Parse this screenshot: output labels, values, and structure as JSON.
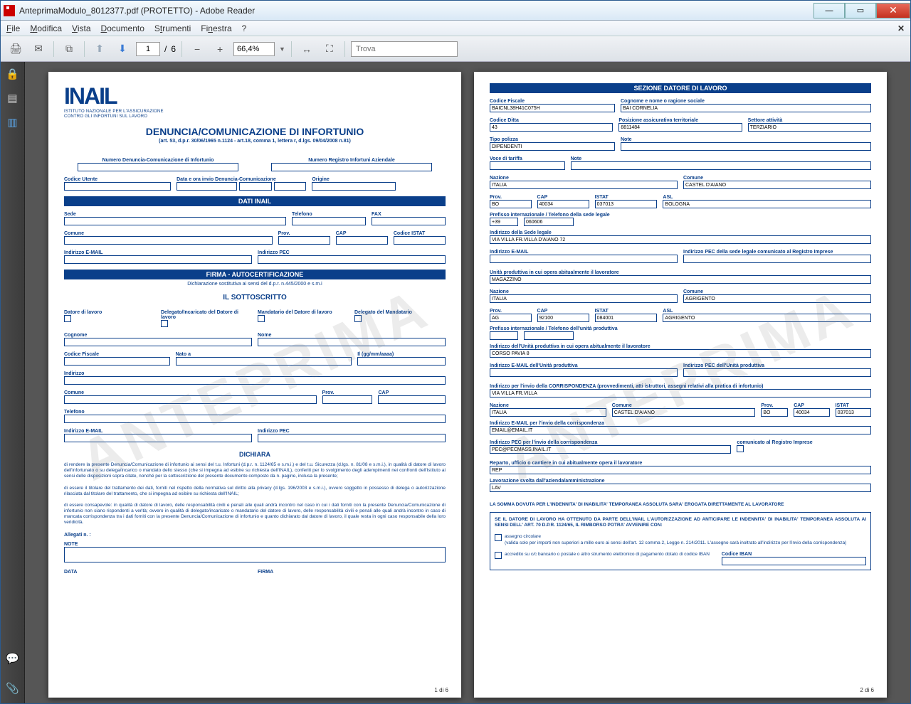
{
  "window": {
    "title": "AnteprimaModulo_8012377.pdf (PROTETTO) - Adobe Reader"
  },
  "menu": {
    "file": "File",
    "edit": "Modifica",
    "view": "Vista",
    "document": "Documento",
    "tools": "Strumenti",
    "window": "Finestra",
    "help": "?"
  },
  "toolbar": {
    "page_current": "1",
    "page_sep": "/",
    "page_total": "6",
    "zoom": "66,4%",
    "search_placeholder": "Trova"
  },
  "page1": {
    "logo": "INAIL",
    "logo_sub1": "ISTITUTO NAZIONALE PER L'ASSICURAZIONE",
    "logo_sub2": "CONTRO GLI INFORTUNI SUL LAVORO",
    "title": "DENUNCIA/COMUNICAZIONE DI INFORTUNIO",
    "subtitle": "(art. 53, d.p.r. 30/06/1965 n.1124 - art.18, comma 1, lettera r, d.lgs. 09/04/2008 n.81)",
    "l_num_denuncia": "Numero Denuncia-Comunicazione di Infortunio",
    "l_num_registro": "Numero Registro Infortuni Aziendale",
    "l_codice_utente": "Codice Utente",
    "l_data_invio": "Data e ora invio Denuncia-Comunicazione",
    "l_origine": "Origine",
    "bar_dati": "DATI INAIL",
    "l_sede": "Sede",
    "l_tel": "Telefono",
    "l_fax": "FAX",
    "l_comune": "Comune",
    "l_prov": "Prov.",
    "l_cap": "CAP",
    "l_istat": "Codice ISTAT",
    "l_email": "Indirizzo E-MAIL",
    "l_pec": "Indirizzo PEC",
    "bar_firma": "FIRMA - AUTOCERTIFICAZIONE",
    "firma_sub": "Dichiarazione sostitutiva ai sensi del d.p.r. n.445/2000 e s.m.i",
    "sottoscritto": "IL SOTTOSCRITTO",
    "chk1": "Datore di lavoro",
    "chk2": "Delegato/Incaricato del Datore di lavoro",
    "chk3": "Mandatario del Datore di lavoro",
    "chk4": "Delegato del Mandatario",
    "l_cognome": "Cognome",
    "l_nome": "Nome",
    "l_cf": "Codice Fiscale",
    "l_natoa": "Nato a",
    "l_il": "Il (gg/mm/aaaa)",
    "l_indirizzo": "Indirizzo",
    "l_telefono": "Telefono",
    "dichiara": "DICHIARA",
    "para1": "di rendere la presente Denuncia/Comunicazione di infortunio ai sensi del t.u. Infortuni (d.p.r. n. 1124/65 e s.m.i.) e del t.u. Sicurezza (d.lgs. n. 81/08 e s.m.i.), in qualità di datore di lavoro dell'infortunato o su delega/incarico o mandato dello stesso (che si impegna ad esibire su richiesta  dell'INAIL), conferiti per lo svolgimento degli adempimenti nei confronti dell'Istituto ai sensi delle disposizioni sopra citate, nonché per la sottoscrizione del presente documento composto da n.     pagine, inclusa la presente;",
    "para2": "di essere il titolare del trattamento dei dati, forniti nel rispetto della normativa sul diritto alla privacy (d.lgs. 196/2003 e s.m.i.), ovvero soggetto in possesso di delega o autorizzazione rilasciata dal titolare del trattamento, che si impegna ad esibire su richiesta dell'INAIL;",
    "para3": "di essere consapevole: in qualità di datore di lavoro, delle responsabilità civili e penali alle quali andrà incontro nel caso in cui i dati forniti con la presente Denuncia/Comunicazione di infortunio non siano rispondenti a verità; ovvero in qualità di delegato/incaricato o mandatario  del datore di lavoro, delle responsabilità civili e penali alle quali andrà incontro in caso di mancata corrispondenza tra i dati forniti con la presente Denuncia/Comunicazione di infortunio e quanto dichiarato dal datore di lavoro, il quale resta in ogni caso responsabile della loro veridicità.",
    "l_allegati": "Allegati n. :",
    "l_note": "NOTE",
    "l_data": "DATA",
    "l_firma": "FIRMA",
    "pageno": "1 di 6"
  },
  "page2": {
    "bar_sezione": "SEZIONE DATORE DI LAVORO",
    "l_cf": "Codice Fiscale",
    "v_cf": "BAICNL38H41C075H",
    "l_cognome_rag": "Cognome e nome o ragione sociale",
    "v_cognome_rag": "BAI CORNELIA",
    "l_cod_ditta": "Codice Ditta",
    "v_cod_ditta": "43",
    "l_pos_ass": "Posizione assicurativa territoriale",
    "v_pos_ass": "8811484",
    "l_settore": "Settore attività",
    "v_settore": "TERZIARIO",
    "l_tipo_pol": "Tipo polizza",
    "v_tipo_pol": "DIPENDENTI",
    "l_note": "Note",
    "l_voce": "Voce di tariffa",
    "l_nazione": "Nazione",
    "v_nazione": "ITALIA",
    "l_comune": "Comune",
    "v_comune": "CASTEL D'AIANO",
    "l_prov": "Prov.",
    "v_prov": "BO",
    "l_cap": "CAP",
    "v_cap": "40034",
    "l_istat": "ISTAT",
    "v_istat": "037013",
    "l_asl": "ASL",
    "v_asl": "BOLOGNA",
    "l_prefisso": "Prefisso internazionale / Telefono della sede legale",
    "v_pref1": "+39",
    "v_pref2": "060606",
    "l_ind_sede": "Indirizzo della Sede legale",
    "v_ind_sede": "VIA VILLA  FR.VILLA D'AIANO 72",
    "l_email": "Indirizzo E-MAIL",
    "l_pec_sede": "Indirizzo PEC della sede legale comunicato al Registro Imprese",
    "l_unita": "Unità produttiva in cui opera abitualmente il lavoratore",
    "v_unita": "MAGAZZINO",
    "v_nazione2": "ITALIA",
    "v_comune2": "AGRIGENTO",
    "v_prov2": "AG",
    "v_cap2": "92100",
    "v_istat2": "084001",
    "v_asl2": "AGRIGENTO",
    "l_pref_unita": "Prefisso internazionale / Telefono dell'unità produttiva",
    "l_ind_unita": "Indirizzo dell'Unità produttiva in cui opera abitualmente il lavoratore",
    "v_ind_unita": "CORSO PAVIA 8",
    "l_email_unita": "Indirizzo E-MAIL dell'Unità produttiva",
    "l_pec_unita": "Indirizzo PEC dell'Unità produttiva",
    "l_corrisp": "Indirizzo per l'invio della CORRISPONDENZA (provvedimenti, atti istruttori, assegni relativi alla pratica di infortunio)",
    "v_corrisp": "VIA VILLA  FR.VILLA",
    "v_comune3": "CASTEL D'AIANO",
    "v_prov3": "BO",
    "v_cap3": "40034",
    "v_istat3": "037013",
    "l_email_corr": "Indirizzo E-MAIL per l'invio della corrispondenza",
    "v_email_corr": "EMAIL@EMAIL.IT",
    "l_pec_corr": "Indirizzo PEC per l'invio della corrispondenza",
    "v_pec_corr": "PEC@PECMASS.INAIL.IT",
    "l_comun_reg": "comunicato al Registro Imprese",
    "l_reparto": "Reparto, ufficio o cantiere in cui abitualmente opera il lavoratore",
    "v_reparto": "REP",
    "l_lavorazione": "Lavorazione svolta dall'azienda/amministrazione",
    "v_lavorazione": "LAV",
    "indennita": "LA SOMMA DOVUTA PER L'INDENNITA' DI INABILITA' TEMPORANEA ASSOLUTA SARA' EROGATA DIRETTAMENTE AL LAVORATORE",
    "box_text": "SE IL DATORE DI LAVORO HA OTTENUTO DA PARTE DELL'INAIL L'AUTORIZZAZIONE AD ANTICIPARE LE INDENNITA' DI INABILITA' TEMPORANEA ASSOLUTA AI SENSI DELL' ART. 70 D.P.R. 1124/65, IL RIMBORSO POTRA' AVVENIRE CON:",
    "opt1": "assegno circolare",
    "opt1_sub": "(valida solo per importi non superiori a mille euro ai sensi dell'art. 12 comma 2, Legge n. 214/2011. L'assegno sarà inoltrato all'indirizzo per l'invio della corrispondenza)",
    "opt2": "accredito su c/c bancario o postale o altro strumento elettronico di pagamento dotato di codice IBAN",
    "l_iban": "Codice IBAN",
    "pageno": "2 di 6"
  }
}
